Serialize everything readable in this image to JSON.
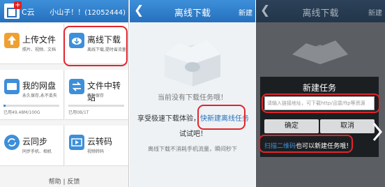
{
  "panel1": {
    "brand": "C云",
    "account": "小山子！！(12052444)",
    "tiles": [
      {
        "label": "上传文件",
        "sub": "照片、视频、文档",
        "icon": "upload-icon",
        "color": "#f0a030"
      },
      {
        "label": "离线下载",
        "sub": "离线下载,提时省流量",
        "icon": "cloud-download-icon",
        "color": "#3d8fd9"
      },
      {
        "label": "我的网盘",
        "sub": "永久保存,永不丢失",
        "icon": "drive-icon",
        "color": "#3d8fd9",
        "quota": "已用49.48M/100G",
        "progress": 0.02
      },
      {
        "label": "文件中转站",
        "sub": "临时保存",
        "icon": "transfer-icon",
        "color": "#3d8fd9",
        "quota": "已用0B/1T",
        "progress": 0.0
      },
      {
        "label": "云同步",
        "sub": "同步手机、相机",
        "icon": "sync-icon",
        "color": "#3d8fd9"
      },
      {
        "label": "云转码",
        "sub": "视频转码",
        "icon": "transcode-icon",
        "color": "#3d8fd9"
      }
    ],
    "footer": "帮助 | 反馈"
  },
  "panel2": {
    "title": "离线下载",
    "new_label": "新建",
    "empty_text": "当前没有下载任务哦！",
    "hint_prefix": "享受极速下载体验，",
    "hint_link": "快新建离线任务",
    "hint_suffix": "试试吧！",
    "sub_text": "离线下载不消耗手机流量，瞬间秒下"
  },
  "panel3": {
    "title": "离线下载",
    "new_label": "新建",
    "dialog_title": "新建任务",
    "input_placeholder": "请输入链接地址，可下载http/迅雷/ftp等资源",
    "confirm_label": "确定",
    "cancel_label": "取消",
    "scan_link": "扫描二维码",
    "scan_suffix": "也可以新建任务哦！"
  },
  "colors": {
    "accent": "#2670bd",
    "highlight": "#e1252b"
  }
}
